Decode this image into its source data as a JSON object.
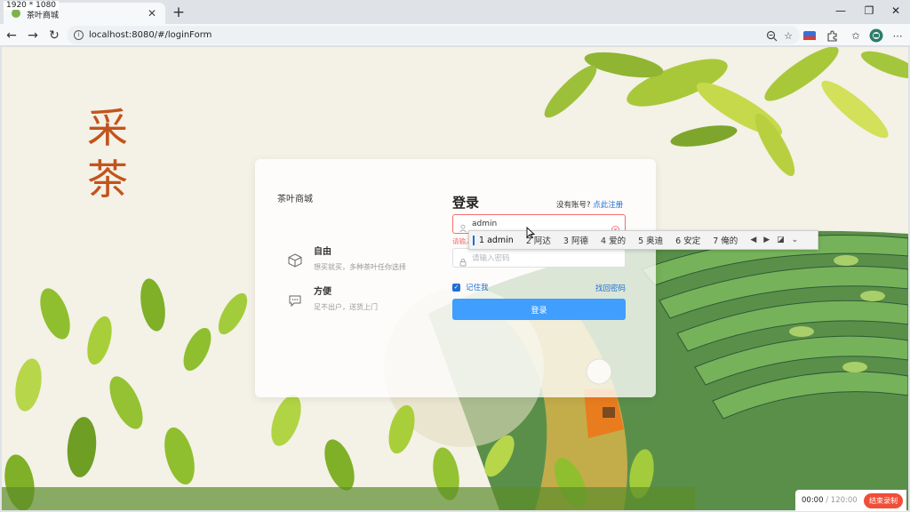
{
  "screen_label": "1920 * 1080",
  "browser": {
    "tab_title": "茶叶商城",
    "url": "localhost:8080/#/loginForm"
  },
  "page": {
    "calligraphy": "采茶",
    "shop_name": "茶叶商城",
    "features": [
      {
        "title": "自由",
        "desc": "想买就买，多种茶叶任你选择"
      },
      {
        "title": "方便",
        "desc": "足不出户，送货上门"
      }
    ],
    "login": {
      "title": "登录",
      "no_account": "没有账号?",
      "register_link": "点此注册",
      "username_value": "admin",
      "username_error": "请输入",
      "password_placeholder": "请输入密码",
      "remember_label": "记住我",
      "forgot_label": "找回密码",
      "submit_label": "登录"
    }
  },
  "ime": {
    "candidates": [
      "1 admin",
      "2 阿达",
      "3 阿德",
      "4 爱的",
      "5 奥迪",
      "6 安定",
      "7 俺的"
    ]
  },
  "recorder": {
    "elapsed": "00:00",
    "separator": " / ",
    "total": "120:00",
    "stop_label": "结束录制"
  }
}
